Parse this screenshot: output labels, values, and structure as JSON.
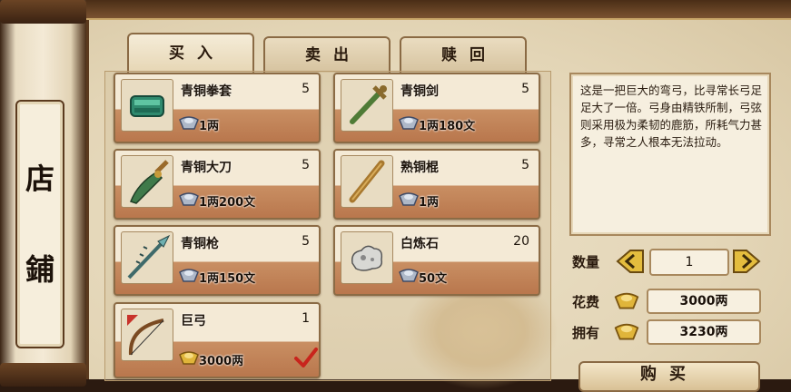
{
  "scroll": {
    "title_char_1": "店",
    "title_char_2": "鋪"
  },
  "tabs": [
    {
      "label": "买入",
      "active": true
    },
    {
      "label": "卖出",
      "active": false
    },
    {
      "label": "赎回",
      "active": false
    }
  ],
  "items": [
    {
      "name": "青铜拳套",
      "qty": "5",
      "price": "1两",
      "icon": "bronze-knuckle-icon",
      "coin": "silver"
    },
    {
      "name": "青铜剑",
      "qty": "5",
      "price": "1两180文",
      "icon": "bronze-sword-icon",
      "coin": "silver"
    },
    {
      "name": "青铜大刀",
      "qty": "5",
      "price": "1两200文",
      "icon": "bronze-broadsword-icon",
      "coin": "silver"
    },
    {
      "name": "熟铜棍",
      "qty": "5",
      "price": "1两",
      "icon": "copper-staff-icon",
      "coin": "silver"
    },
    {
      "name": "青铜枪",
      "qty": "5",
      "price": "1两150文",
      "icon": "bronze-spear-icon",
      "coin": "silver"
    },
    {
      "name": "白炼石",
      "qty": "20",
      "price": "50文",
      "icon": "white-stone-icon",
      "coin": "silver"
    },
    {
      "name": "巨弓",
      "qty": "1",
      "price": "3000两",
      "icon": "giant-bow-icon",
      "coin": "gold",
      "selected": true
    }
  ],
  "description": "这是一把巨大的弯弓，比寻常长弓足足大了一倍。弓身由精铁所制，弓弦则采用极为柔韧的鹿筋，所耗气力甚多，寻常之人根本无法拉动。",
  "quantity": {
    "label": "数量",
    "value": "1"
  },
  "cost": {
    "label": "花费",
    "value": "3000两"
  },
  "owned": {
    "label": "拥有",
    "value": "3230两"
  },
  "buy_button": {
    "label": "购买"
  },
  "colors": {
    "accent": "#8b6b45",
    "price_band": "#c98f63",
    "gold": "#e0b53a"
  }
}
